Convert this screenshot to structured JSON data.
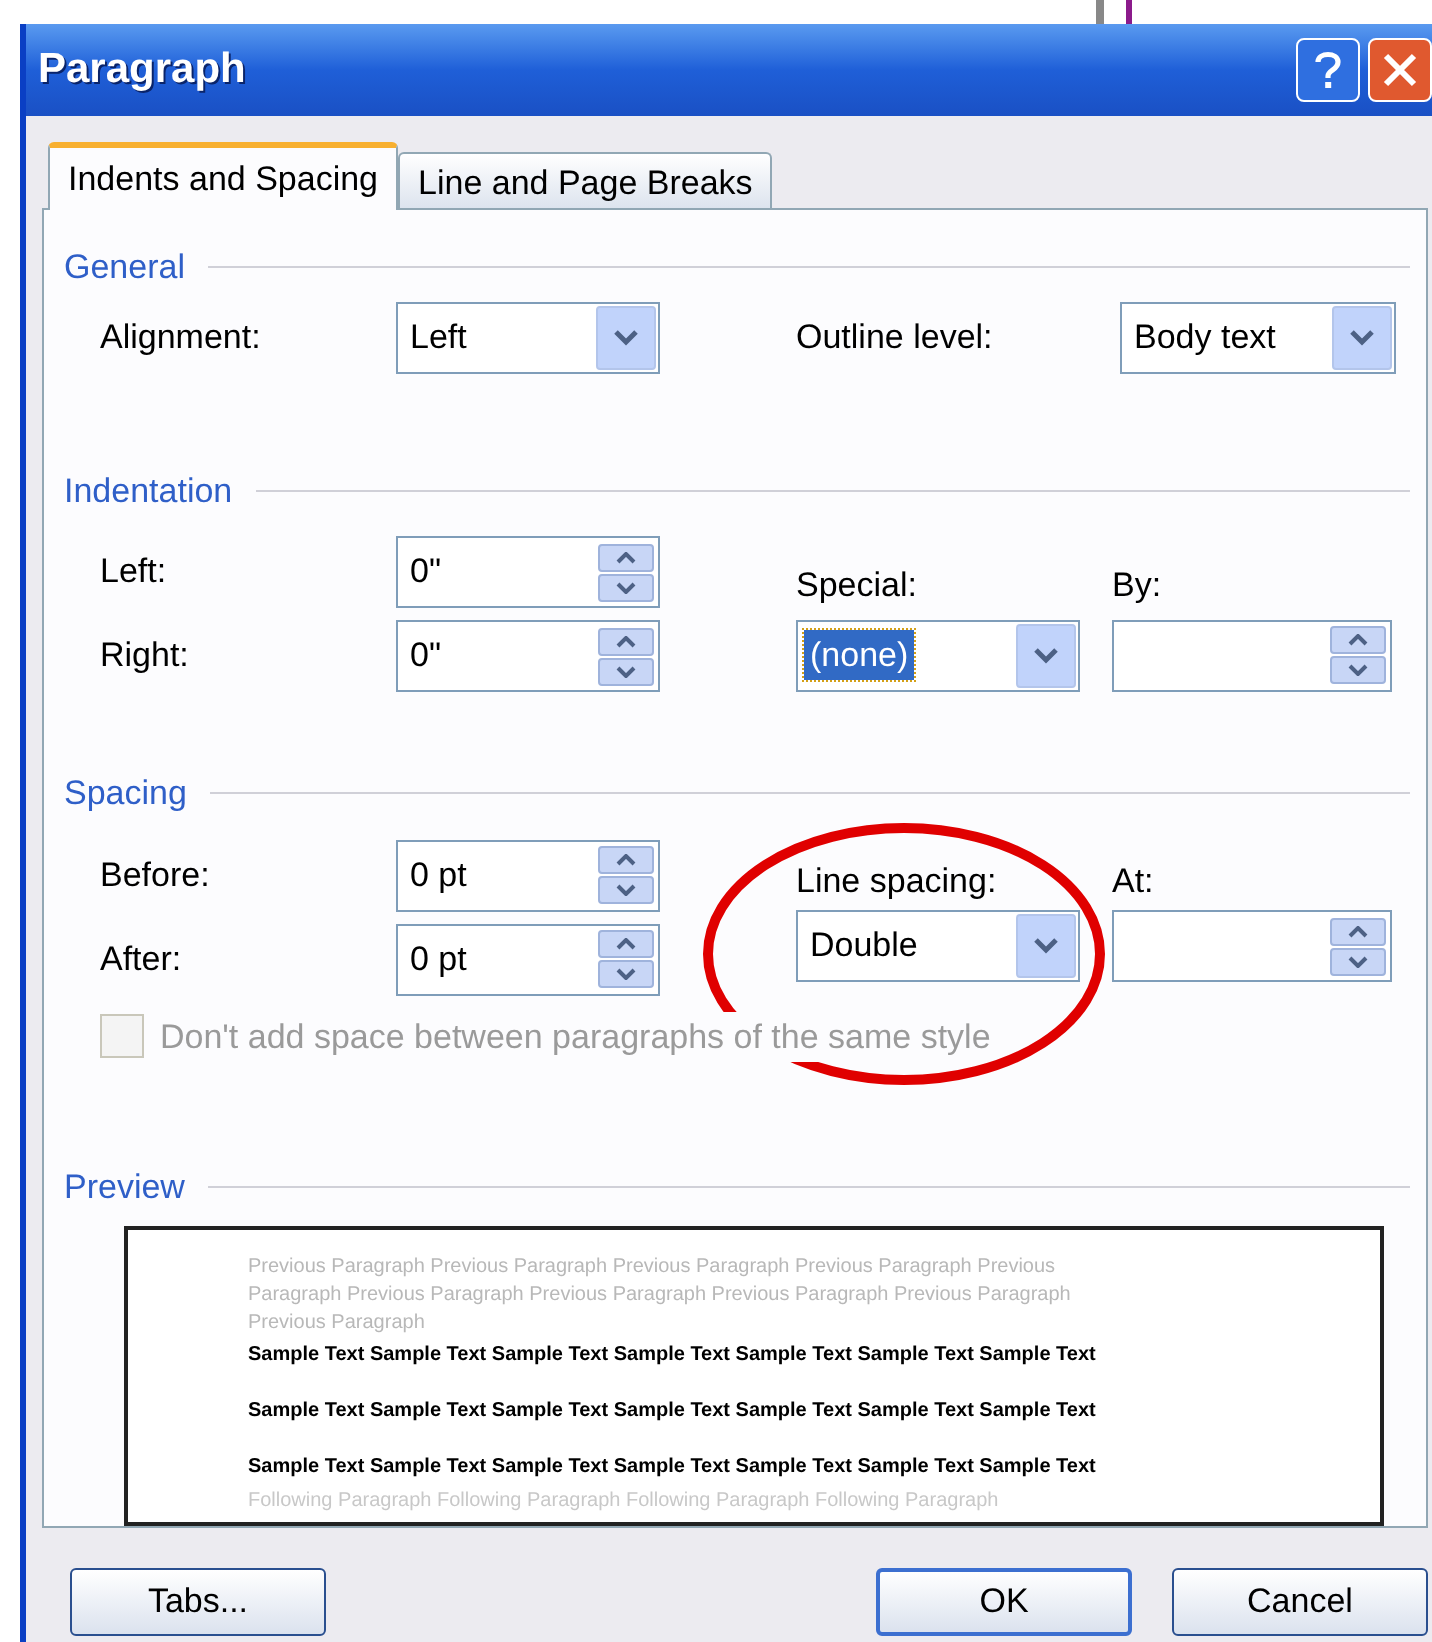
{
  "window": {
    "title": "Paragraph"
  },
  "tabs": [
    {
      "label": "Indents and Spacing",
      "selected": true
    },
    {
      "label": "Line and Page Breaks",
      "selected": false
    }
  ],
  "general": {
    "title": "General",
    "alignment": {
      "label": "Alignment:",
      "value": "Left"
    },
    "outline_level": {
      "label": "Outline level:",
      "value": "Body text"
    }
  },
  "indentation": {
    "title": "Indentation",
    "left": {
      "label": "Left:",
      "value": "0\""
    },
    "right": {
      "label": "Right:",
      "value": "0\""
    },
    "special": {
      "label": "Special:",
      "value": "(none)",
      "highlighted": true
    },
    "by": {
      "label": "By:"
    }
  },
  "spacing": {
    "title": "Spacing",
    "before": {
      "label": "Before:",
      "value": "0 pt"
    },
    "after": {
      "label": "After:",
      "value": "0 pt"
    },
    "line_spacing": {
      "label": "Line spacing:",
      "value": "Double",
      "highlighted": false
    },
    "at": {
      "label": "At:"
    },
    "checkbox": {
      "label": "Don't add space between paragraphs of the same style",
      "checked": false,
      "disabled": true
    }
  },
  "preview": {
    "title": "Preview",
    "previous_lines": [
      "Previous Paragraph Previous Paragraph Previous Paragraph Previous Paragraph Previous",
      "Paragraph Previous Paragraph Previous Paragraph Previous Paragraph Previous Paragraph",
      "Previous Paragraph"
    ],
    "sample_lines": [
      "Sample Text Sample Text Sample Text Sample Text Sample Text Sample Text Sample Text",
      "Sample Text Sample Text Sample Text Sample Text Sample Text Sample Text Sample Text",
      "Sample Text Sample Text Sample Text Sample Text Sample Text Sample Text Sample Text"
    ],
    "following_lines": [
      "Following Paragraph Following Paragraph Following Paragraph Following Paragraph"
    ]
  },
  "buttons": [
    {
      "label": "Tabs...",
      "default": false
    },
    {
      "label": "OK",
      "default": true
    },
    {
      "label": "Cancel",
      "default": false
    }
  ]
}
